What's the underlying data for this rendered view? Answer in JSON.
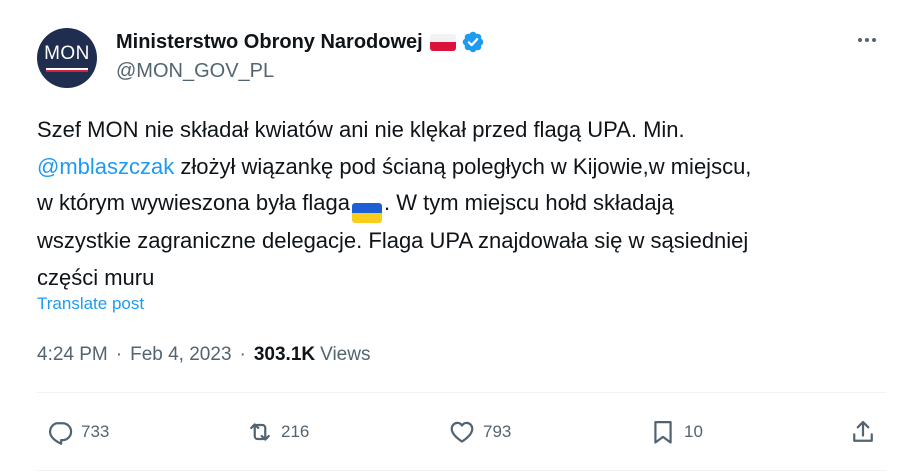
{
  "account": {
    "avatar_text": "MON",
    "display_name": "Ministerstwo Obrony Narodowej",
    "handle": "@MON_GOV_PL",
    "flag_icon": "poland-flag-emoji",
    "verified_icon": "verified-badge-icon"
  },
  "post": {
    "line1": "Szef MON nie składał kwiatów ani nie klękał przed flagą UPA. Min.",
    "mention": "@mblaszczak",
    "line2_rest": " złożył wiązankę pod ścianą poległych w Kijowie,w miejscu,",
    "line3_before": "w którym wywieszona była flaga",
    "line3_after": ". W tym miejscu hołd składają",
    "line4": "wszystkie zagraniczne delegacje. Flaga UPA znajdowała się w sąsiedniej",
    "line5": "części muru",
    "inline_icon": "ukraine-flag-emoji"
  },
  "translate_label": "Translate post",
  "meta": {
    "time": "4:24 PM",
    "separator": "·",
    "date": "Feb 4, 2023",
    "views_count": "303.1K",
    "views_label": "Views"
  },
  "actions": {
    "replies": "733",
    "reposts": "216",
    "likes": "793",
    "bookmarks": "10"
  },
  "colors": {
    "text": "#0f1419",
    "secondary": "#536471",
    "link": "#1d9bf0",
    "avatar_bg": "#1f2d4e"
  }
}
